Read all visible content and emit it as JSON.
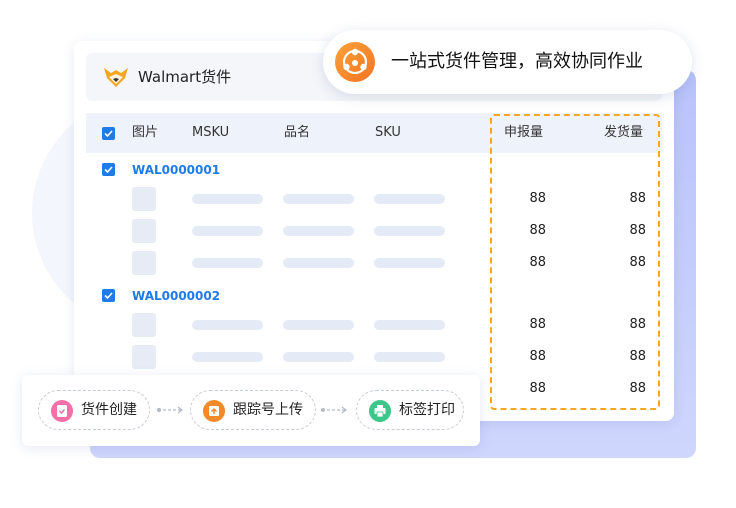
{
  "banner": {
    "text": "一站式货件管理，高效协同作业"
  },
  "card": {
    "title": "Walmart货件"
  },
  "table": {
    "headers": {
      "image": "图片",
      "msku": "MSKU",
      "name": "品名",
      "sku": "SKU",
      "declared": "申报量",
      "shipped": "发货量"
    },
    "groups": [
      {
        "order": "WAL0000001",
        "rows": [
          {
            "declared": "88",
            "shipped": "88"
          },
          {
            "declared": "88",
            "shipped": "88"
          },
          {
            "declared": "88",
            "shipped": "88"
          }
        ]
      },
      {
        "order": "WAL0000002",
        "rows": [
          {
            "declared": "88",
            "shipped": "88"
          },
          {
            "declared": "88",
            "shipped": "88"
          },
          {
            "declared": "88",
            "shipped": "88"
          }
        ]
      }
    ]
  },
  "workflow": {
    "steps": [
      {
        "label": "货件创建",
        "icon": "clipboard-check-icon",
        "color": "#f36fa8"
      },
      {
        "label": "跟踪号上传",
        "icon": "upload-icon",
        "color": "#f28a2a"
      },
      {
        "label": "标签打印",
        "icon": "printer-icon",
        "color": "#3ec78a"
      }
    ]
  },
  "colors": {
    "accent": "#1e7be8",
    "highlight_border": "#f5a623",
    "brand_orange": "#f27322"
  }
}
